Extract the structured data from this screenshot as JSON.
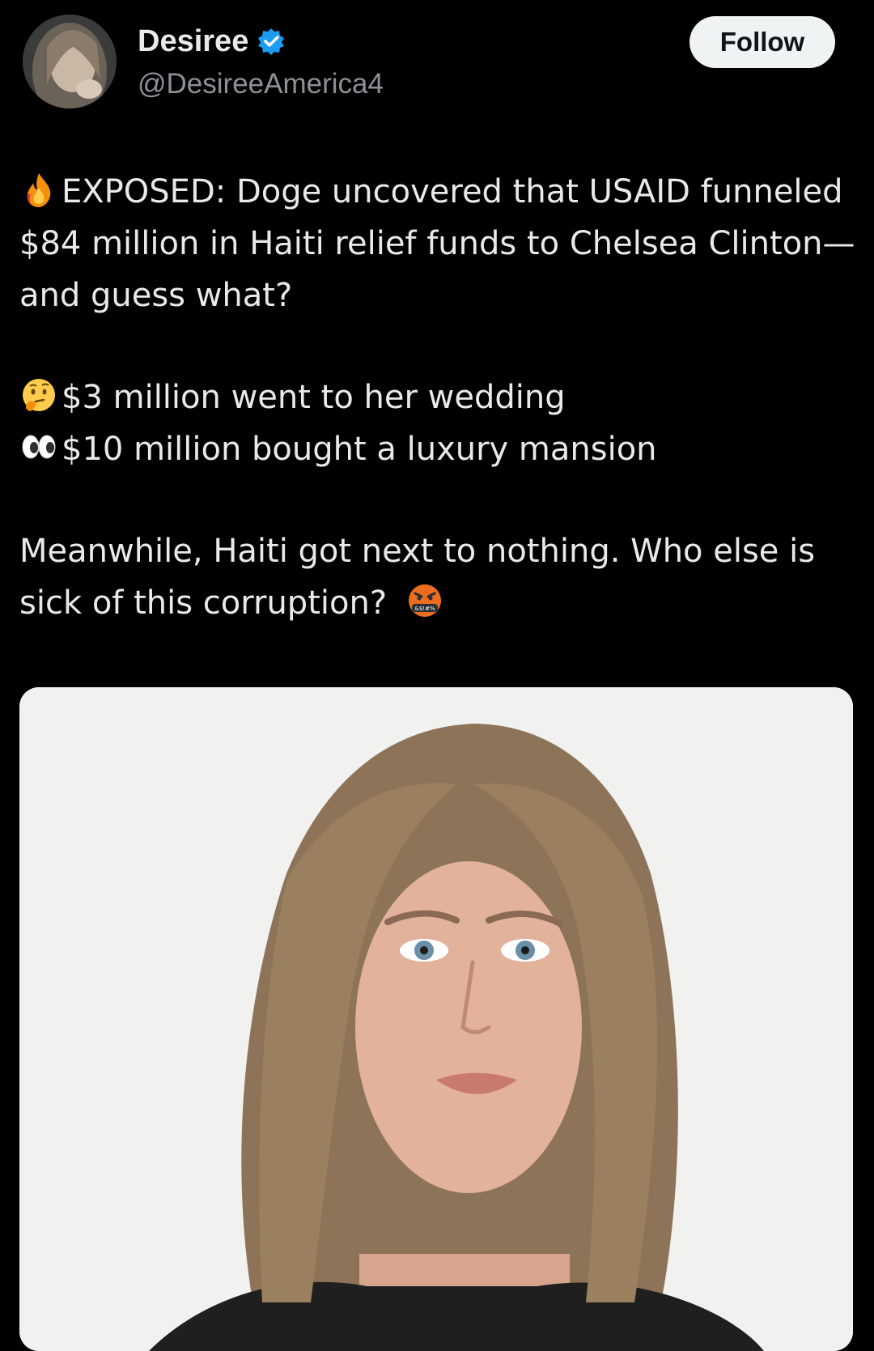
{
  "user": {
    "display_name": "Desiree",
    "handle": "@DesireeAmerica4",
    "verified": true
  },
  "actions": {
    "follow_label": "Follow"
  },
  "tweet": {
    "line1": "EXPOSED: Doge uncovered that USAID funneled $84 million in Haiti relief funds to Chelsea Clinton—and guess what?",
    "bullet1": "$3 million went to her wedding",
    "bullet2": "$10 million bought a luxury mansion",
    "closing": "Meanwhile, Haiti got next to nothing. Who else is sick of this corruption?",
    "emojis": [
      "fire",
      "thinking-face",
      "eyes",
      "cursing-face"
    ]
  },
  "media": {
    "type": "photo"
  },
  "colors": {
    "background": "#000000",
    "text": "#e7e9ea",
    "secondary_text": "#8b9197",
    "verified_blue": "#1d9bf0",
    "follow_button_bg": "#eff3f4"
  }
}
